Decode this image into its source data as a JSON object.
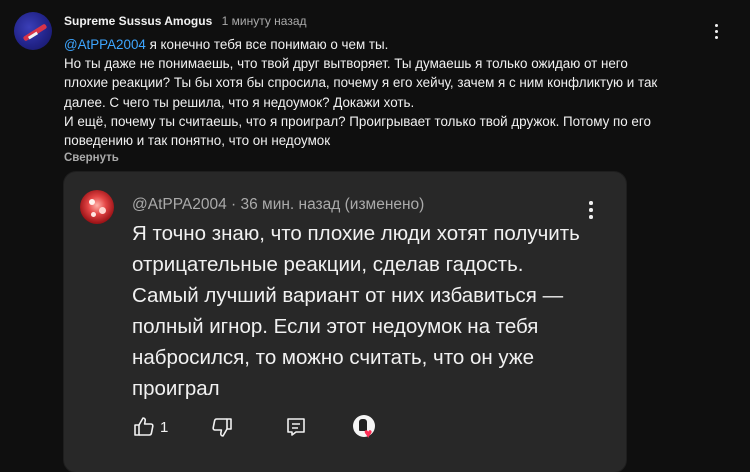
{
  "comment": {
    "author": "Supreme Sussus Amogus",
    "time": "1 минуту назад",
    "mention": "@AtPPA2004",
    "lines": [
      " я конечно тебя все понимаю о чем ты.",
      "Но ты даже не понимаешь, что твой друг вытворяет. Ты думаешь я только ожидаю от него",
      "плохие реакции? Ты бы хотя бы спросила, почему я его хейчу, зачем я с ним конфликтую и так",
      "далее. С чего ты решила, что я недоумок? Докажи хоть.",
      " И ещё, почему ты считаешь, что я проиграл? Проигрывает только твой дружок. Потому по его",
      "поведению и так понятно, что он недоумок"
    ],
    "collapse_label": "Свернуть",
    "menu_icon": "more-vert-icon"
  },
  "quoted": {
    "header": "@AtPPA2004 · 36 мин. назад (изменено)",
    "lines": [
      "Я точно знаю, что плохие люди хотят получить",
      "отрицательные реакции, сделав гадость.",
      "Самый лучший вариант от них избавиться —",
      "полный игнор. Если этот недоумок на тебя",
      "набросился, то можно считать, что он уже",
      "проиграл"
    ],
    "likes": "1",
    "icons": {
      "like": "thumb-up-icon",
      "dislike": "thumb-down-icon",
      "reply": "reply-icon",
      "creator_heart": "creator-heart-icon",
      "menu": "more-vert-icon"
    }
  },
  "colors": {
    "background": "#0f0f0f",
    "card": "#282828",
    "mention": "#3ea6ff",
    "muted": "#aaaaaa",
    "heart": "#ff2d55"
  }
}
